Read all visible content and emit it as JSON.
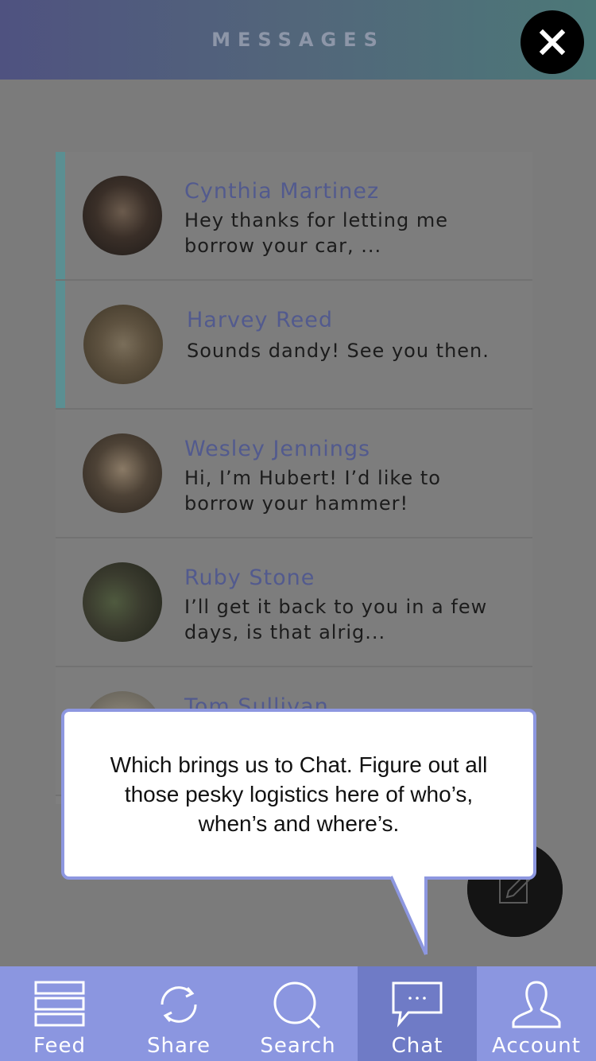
{
  "header": {
    "title": "MESSAGES",
    "close_icon": "close-icon"
  },
  "messages": [
    {
      "name": "Cynthia Martinez",
      "preview_line1": "Hey thanks for letting me",
      "preview_line2": "borrow your car, ...",
      "unread": true
    },
    {
      "name": "Harvey Reed",
      "preview_line1": "Sounds dandy! See you then.",
      "preview_line2": "",
      "unread": true
    },
    {
      "name": "Wesley Jennings",
      "preview_line1": "Hi, I’m Hubert! I’d like to",
      "preview_line2": "borrow your hammer!",
      "unread": false
    },
    {
      "name": "Ruby Stone",
      "preview_line1": "I’ll get it back to you in a few",
      "preview_line2": "days, is that alrig...",
      "unread": false
    },
    {
      "name": "Tom Sullivan",
      "preview_line1": "",
      "preview_line2": "",
      "unread": false
    }
  ],
  "tooltip": {
    "text": "Which brings us to Chat. Figure out all those pesky logistics here of who’s, when’s and where’s."
  },
  "tabs": [
    {
      "label": "Feed",
      "icon": "feed-icon",
      "active": false
    },
    {
      "label": "Share",
      "icon": "share-icon",
      "active": false
    },
    {
      "label": "Search",
      "icon": "search-icon",
      "active": false
    },
    {
      "label": "Chat",
      "icon": "chat-icon",
      "active": true
    },
    {
      "label": "Account",
      "icon": "account-icon",
      "active": false
    }
  ],
  "colors": {
    "header_start": "#4f5280",
    "header_end": "#4c7878",
    "accent": "#8b96e0",
    "active_tab": "#6f7bc6",
    "unread_marker": "#5b8f92",
    "name_text": "#525a8e"
  }
}
